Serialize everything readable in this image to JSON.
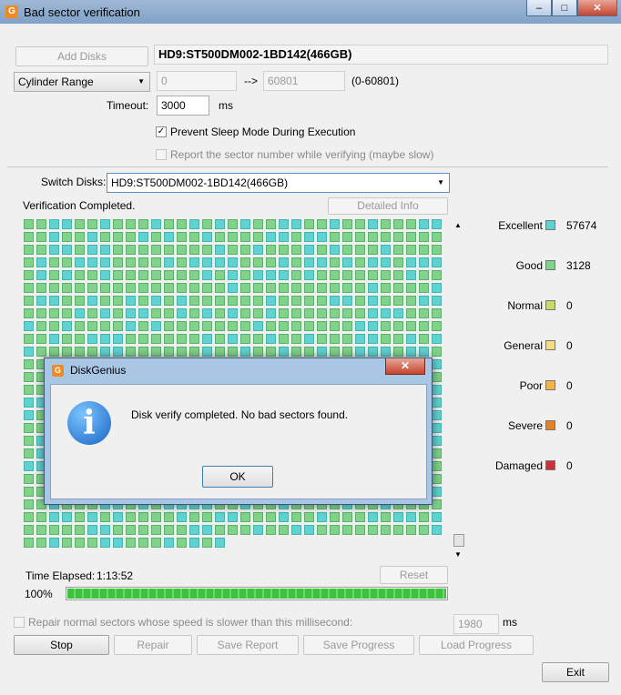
{
  "window": {
    "title": "Bad sector verification",
    "buttons": {
      "minimize": "–",
      "maximize": "□",
      "close": "✕"
    }
  },
  "top": {
    "add_disks": "Add Disks",
    "disk_name": "HD9:ST500DM002-1BD142(466GB)",
    "range_select": "Cylinder Range",
    "range_start": "0",
    "arrow": "-->",
    "range_end": "60801",
    "range_hint": "(0-60801)",
    "timeout_label": "Timeout:",
    "timeout_value": "3000",
    "timeout_unit": "ms",
    "prevent_sleep": "Prevent Sleep Mode During Execution",
    "report_sector": "Report the sector number while verifying (maybe slow)"
  },
  "switch": {
    "label": "Switch Disks:",
    "value": "HD9:ST500DM002-1BD142(466GB)"
  },
  "status": {
    "text": "Verification Completed.",
    "detailed_info": "Detailed Info"
  },
  "legend": [
    {
      "name": "Excellent",
      "value": "57674",
      "color": "#5fd3cf"
    },
    {
      "name": "Good",
      "value": "3128",
      "color": "#7fd38a"
    },
    {
      "name": "Normal",
      "value": "0",
      "color": "#c8d86a"
    },
    {
      "name": "General",
      "value": "0",
      "color": "#f2dd8a"
    },
    {
      "name": "Poor",
      "value": "0",
      "color": "#f3b54a"
    },
    {
      "name": "Severe",
      "value": "0",
      "color": "#e0842a"
    },
    {
      "name": "Damaged",
      "value": "0",
      "color": "#c8323a"
    }
  ],
  "progress": {
    "elapsed_label": "Time Elapsed:",
    "elapsed": "1:13:52",
    "reset": "Reset",
    "percent": "100%",
    "fraction": 1.0
  },
  "repair": {
    "label": "Repair normal sectors whose speed is slower than this millisecond:",
    "value": "1980",
    "unit": "ms"
  },
  "actions": {
    "stop": "Stop",
    "repair": "Repair",
    "save_report": "Save Report",
    "save_progress": "Save Progress",
    "load_progress": "Load Progress",
    "exit": "Exit"
  },
  "dialog": {
    "title": "DiskGenius",
    "message": "Disk verify completed. No bad sectors found.",
    "ok": "OK",
    "close": "✕",
    "icon": "info-icon"
  },
  "colors": {
    "excellent": "#5fd3cf",
    "good": "#7fd38a",
    "progress": "#3ec13e"
  }
}
